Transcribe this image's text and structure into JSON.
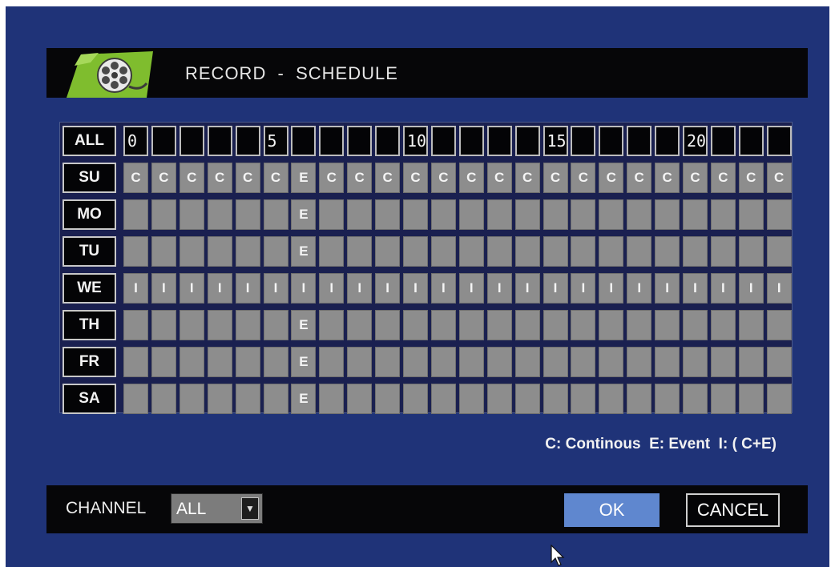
{
  "title": "RECORD  -  SCHEDULE",
  "grid": {
    "all_label": "ALL",
    "hour_labels": [
      "0",
      "",
      "",
      "",
      "",
      "5",
      "",
      "",
      "",
      "",
      "10",
      "",
      "",
      "",
      "",
      "15",
      "",
      "",
      "",
      "",
      "20",
      "",
      "",
      ""
    ],
    "rows": [
      {
        "day": "SU",
        "cells": [
          "C",
          "C",
          "C",
          "C",
          "C",
          "C",
          "E",
          "C",
          "C",
          "C",
          "C",
          "C",
          "C",
          "C",
          "C",
          "C",
          "C",
          "C",
          "C",
          "C",
          "C",
          "C",
          "C",
          "C"
        ]
      },
      {
        "day": "MO",
        "cells": [
          "",
          "",
          "",
          "",
          "",
          "",
          "E",
          "",
          "",
          "",
          "",
          "",
          "",
          "",
          "",
          "",
          "",
          "",
          "",
          "",
          "",
          "",
          "",
          ""
        ]
      },
      {
        "day": "TU",
        "cells": [
          "",
          "",
          "",
          "",
          "",
          "",
          "E",
          "",
          "",
          "",
          "",
          "",
          "",
          "",
          "",
          "",
          "",
          "",
          "",
          "",
          "",
          "",
          "",
          ""
        ]
      },
      {
        "day": "WE",
        "cells": [
          "I",
          "I",
          "I",
          "I",
          "I",
          "I",
          "I",
          "I",
          "I",
          "I",
          "I",
          "I",
          "I",
          "I",
          "I",
          "I",
          "I",
          "I",
          "I",
          "I",
          "I",
          "I",
          "I",
          "I"
        ]
      },
      {
        "day": "TH",
        "cells": [
          "",
          "",
          "",
          "",
          "",
          "",
          "E",
          "",
          "",
          "",
          "",
          "",
          "",
          "",
          "",
          "",
          "",
          "",
          "",
          "",
          "",
          "",
          "",
          ""
        ]
      },
      {
        "day": "FR",
        "cells": [
          "",
          "",
          "",
          "",
          "",
          "",
          "E",
          "",
          "",
          "",
          "",
          "",
          "",
          "",
          "",
          "",
          "",
          "",
          "",
          "",
          "",
          "",
          "",
          ""
        ]
      },
      {
        "day": "SA",
        "cells": [
          "",
          "",
          "",
          "",
          "",
          "",
          "E",
          "",
          "",
          "",
          "",
          "",
          "",
          "",
          "",
          "",
          "",
          "",
          "",
          "",
          "",
          "",
          "",
          ""
        ]
      }
    ]
  },
  "legend": "C: Continous  E: Event  I: ( C+E)",
  "channel": {
    "label": "CHANNEL",
    "value": "ALL"
  },
  "buttons": {
    "ok": "OK",
    "cancel": "CANCEL"
  },
  "colors": {
    "background": "#1f3378",
    "ok_button": "#5f87cf",
    "cell": "#8d8d8d",
    "icon_green": "#7fbd2e"
  },
  "icons": {
    "title": "film-reel-icon",
    "dropdown": "chevron-down-icon",
    "cursor": "mouse-pointer-icon"
  }
}
